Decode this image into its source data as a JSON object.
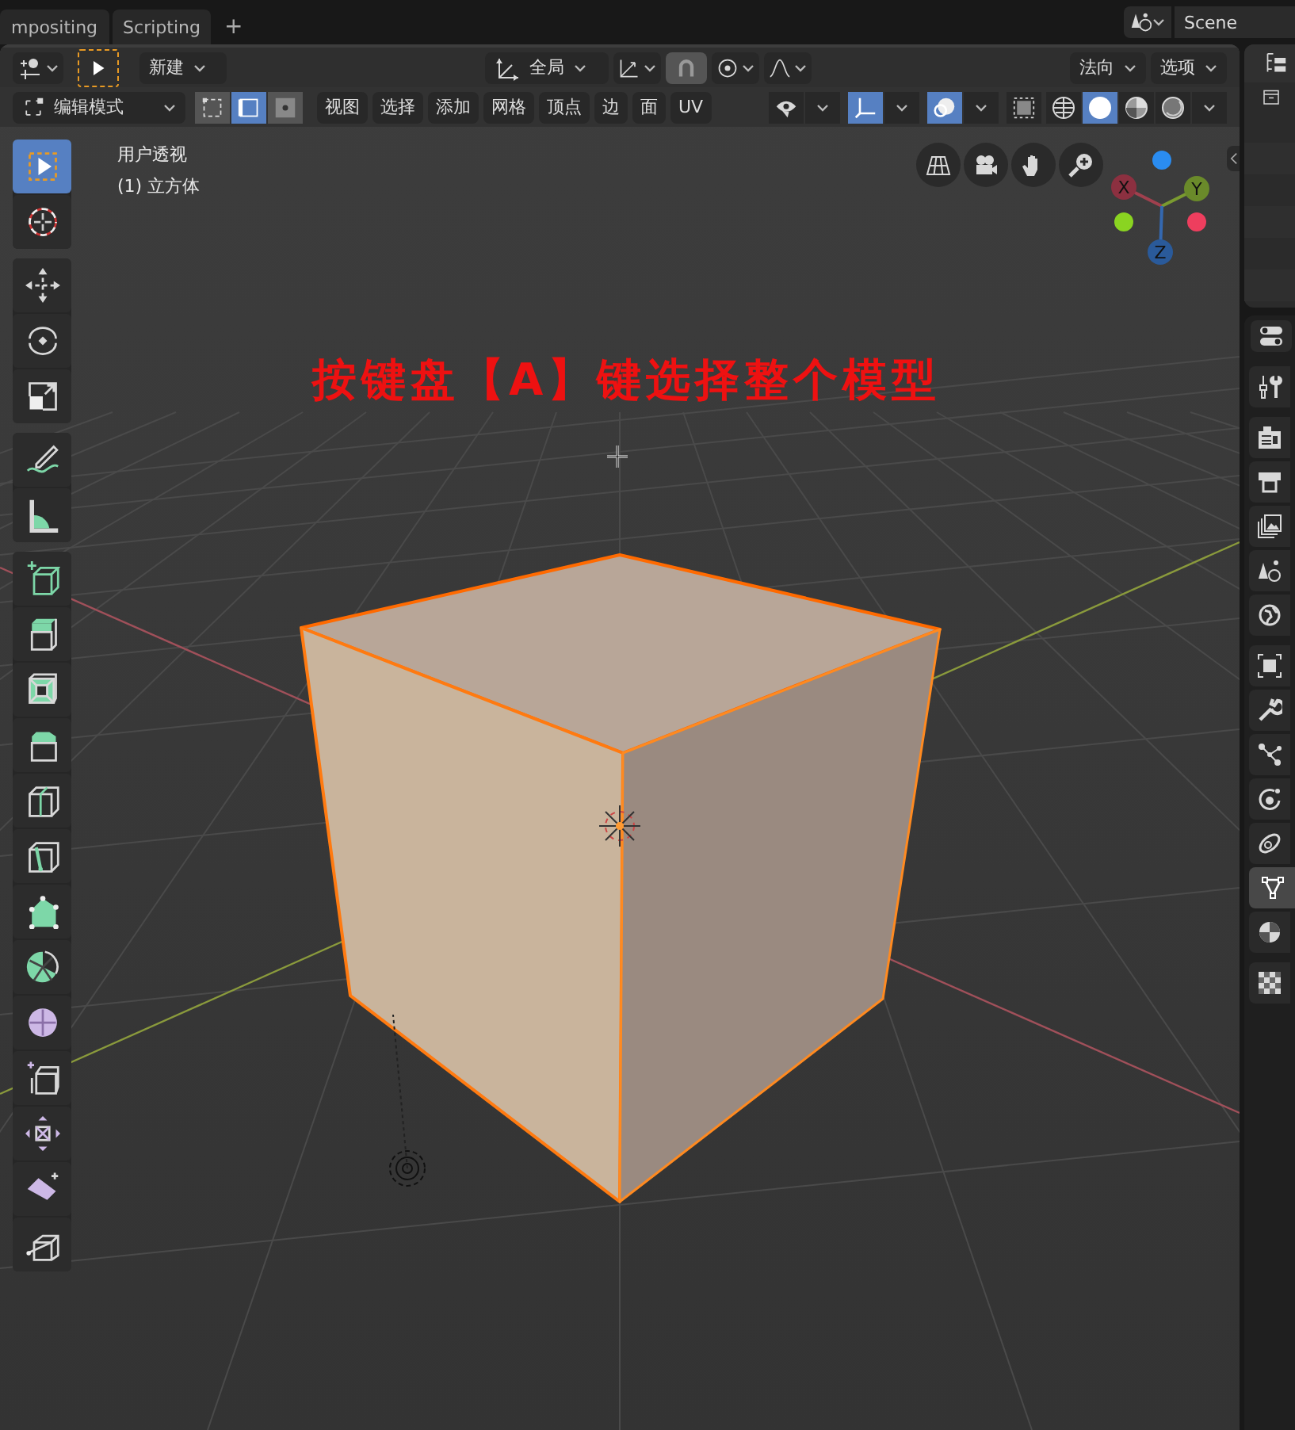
{
  "workspace_tabs": [
    {
      "label": "mpositing",
      "selected": false
    },
    {
      "label": "Scripting",
      "selected": false
    }
  ],
  "add_workspace": "+",
  "scene": {
    "name": "Scene"
  },
  "header": {
    "new_dropdown": "新建",
    "orientation": "全局",
    "normal_dropdown": "法向",
    "options_dropdown": "选项",
    "mode": "编辑模式",
    "snap_tools": [
      {
        "kind": "pivot",
        "on": false
      },
      {
        "kind": "snap",
        "on": true
      },
      {
        "kind": "proportional",
        "on": false
      },
      {
        "kind": "falloff",
        "on": false
      }
    ],
    "select_modes": [
      {
        "kind": "vertex",
        "selected": false
      },
      {
        "kind": "edge",
        "selected": true
      },
      {
        "kind": "face",
        "selected": false
      }
    ],
    "menus": [
      "视图",
      "选择",
      "添加",
      "网格",
      "顶点",
      "边",
      "面",
      "UV"
    ],
    "toggles": [
      {
        "kind": "visibility",
        "on": false
      },
      {
        "kind": "gizmo",
        "on": true
      },
      {
        "kind": "overlay",
        "on": true
      },
      {
        "kind": "xray",
        "on": false
      }
    ],
    "shading_modes": [
      {
        "kind": "wireframe",
        "selected": false
      },
      {
        "kind": "solid",
        "selected": true
      },
      {
        "kind": "material",
        "selected": false
      },
      {
        "kind": "rendered",
        "selected": false
      }
    ]
  },
  "viewport": {
    "view_name": "用户透视",
    "object_name": "(1) 立方体",
    "caption": "按键盘【A】键选择整个模型",
    "axes": [
      "X",
      "Y",
      "Z"
    ],
    "nav_buttons": [
      {
        "kind": "grid"
      },
      {
        "kind": "camera"
      },
      {
        "kind": "hand"
      },
      {
        "kind": "zoom"
      }
    ]
  },
  "tool_groups": [
    [
      {
        "kind": "select_box",
        "selected": true
      },
      {
        "kind": "cursor",
        "selected": false
      }
    ],
    [
      {
        "kind": "move",
        "selected": false
      },
      {
        "kind": "rotate",
        "selected": false
      },
      {
        "kind": "scale",
        "selected": false
      }
    ],
    [
      {
        "kind": "annotate",
        "selected": false
      },
      {
        "kind": "measure",
        "selected": false
      }
    ],
    [
      {
        "kind": "add_cube",
        "selected": false
      },
      {
        "kind": "extrude",
        "selected": false
      },
      {
        "kind": "inset",
        "selected": false
      },
      {
        "kind": "bevel",
        "selected": false
      },
      {
        "kind": "loop_cut",
        "selected": false
      },
      {
        "kind": "knife",
        "selected": false
      },
      {
        "kind": "poly_build",
        "selected": false
      },
      {
        "kind": "spin",
        "selected": false
      },
      {
        "kind": "smooth",
        "selected": false
      },
      {
        "kind": "edge_slide",
        "selected": false
      },
      {
        "kind": "shrink",
        "selected": false
      },
      {
        "kind": "shear",
        "selected": false
      },
      {
        "kind": "rip",
        "selected": false
      }
    ]
  ],
  "property_groups": [
    [
      {
        "kind": "tool",
        "selected": false
      }
    ],
    [
      {
        "kind": "render",
        "selected": false
      },
      {
        "kind": "output",
        "selected": false
      },
      {
        "kind": "view_layer",
        "selected": false
      },
      {
        "kind": "scene",
        "selected": false
      },
      {
        "kind": "world",
        "selected": false
      }
    ],
    [
      {
        "kind": "object",
        "selected": false
      },
      {
        "kind": "modifier",
        "selected": false
      },
      {
        "kind": "particles",
        "selected": false
      },
      {
        "kind": "physics",
        "selected": false
      },
      {
        "kind": "constraints",
        "selected": false
      },
      {
        "kind": "mesh",
        "selected": true
      },
      {
        "kind": "material",
        "selected": false
      }
    ],
    [
      {
        "kind": "texture",
        "selected": false
      }
    ]
  ]
}
